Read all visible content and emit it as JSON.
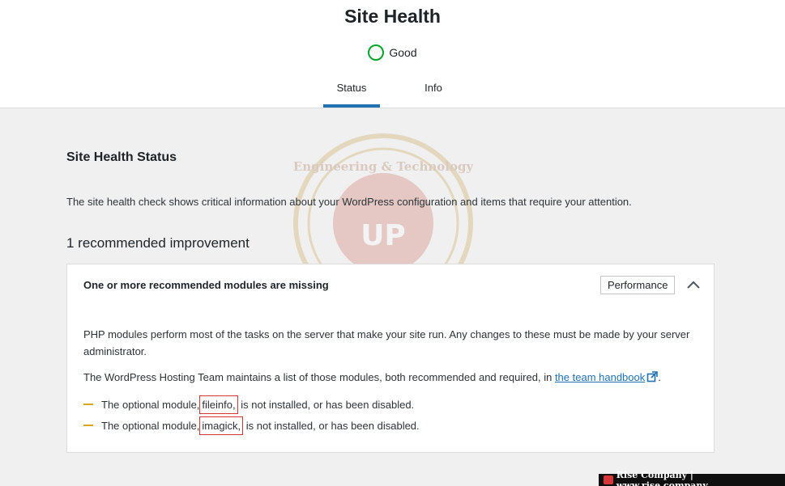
{
  "header": {
    "title": "Site Health",
    "status": "Good",
    "tabs": [
      {
        "label": "Status",
        "active": true
      },
      {
        "label": "Info",
        "active": false
      }
    ]
  },
  "main": {
    "section_title": "Site Health Status",
    "intro": "The site health check shows critical information about your WordPress configuration and items that require your attention.",
    "count_label": "1 recommended improvement",
    "panel": {
      "heading": "One or more recommended modules are missing",
      "badge": "Performance",
      "toggle_icon": "chevron-up-icon",
      "para1": "PHP modules perform most of the tasks on the server that make your site run. Any changes to these must be made by your server administrator.",
      "para2_prefix": "The WordPress Hosting Team maintains a list of those modules, both recommended and required, in ",
      "para2_link": "the team handbook",
      "para2_suffix": ".",
      "items": [
        {
          "prefix": "The optional module,",
          "module": "fileinfo,",
          "suffix": "is not installed, or has been disabled."
        },
        {
          "prefix": "The optional module,",
          "module": "imagick,",
          "suffix": "is not installed, or has been disabled."
        }
      ]
    }
  },
  "watermark": {
    "top_text": "Engineering & Technology",
    "center_text": "UP"
  },
  "footer": {
    "text": "Rise Company | www.rise.company"
  },
  "colors": {
    "accent": "#2271b1",
    "good": "#00a32a",
    "warning": "#dba617",
    "highlight": "#d63638"
  }
}
